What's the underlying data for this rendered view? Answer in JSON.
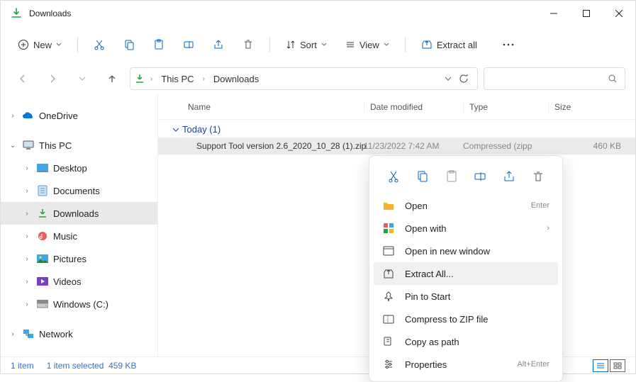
{
  "window": {
    "title": "Downloads"
  },
  "toolbar": {
    "new": "New",
    "sort": "Sort",
    "view": "View",
    "extract_all": "Extract all"
  },
  "breadcrumb": {
    "pc": "This PC",
    "chev": "›",
    "current": "Downloads"
  },
  "sidebar": {
    "onedrive": "OneDrive",
    "thispc": "This PC",
    "desktop": "Desktop",
    "documents": "Documents",
    "downloads": "Downloads",
    "music": "Music",
    "pictures": "Pictures",
    "videos": "Videos",
    "windowsc": "Windows (C:)",
    "network": "Network"
  },
  "columns": {
    "name": "Name",
    "date": "Date modified",
    "type": "Type",
    "size": "Size"
  },
  "group": {
    "label": "Today (1)"
  },
  "file": {
    "name": "Support Tool version 2.6_2020_10_28 (1).zip",
    "date": "11/23/2022 7:42 AM",
    "type": "Compressed (zipp",
    "size": "460 KB"
  },
  "context": {
    "open": "Open",
    "open_hint": "Enter",
    "openwith": "Open with",
    "newwindow": "Open in new window",
    "extract": "Extract All...",
    "pin": "Pin to Start",
    "compress": "Compress to ZIP file",
    "copypath": "Copy as path",
    "properties": "Properties",
    "properties_hint": "Alt+Enter"
  },
  "status": {
    "count": "1 item",
    "selected": "1 item selected",
    "size": "459 KB"
  }
}
